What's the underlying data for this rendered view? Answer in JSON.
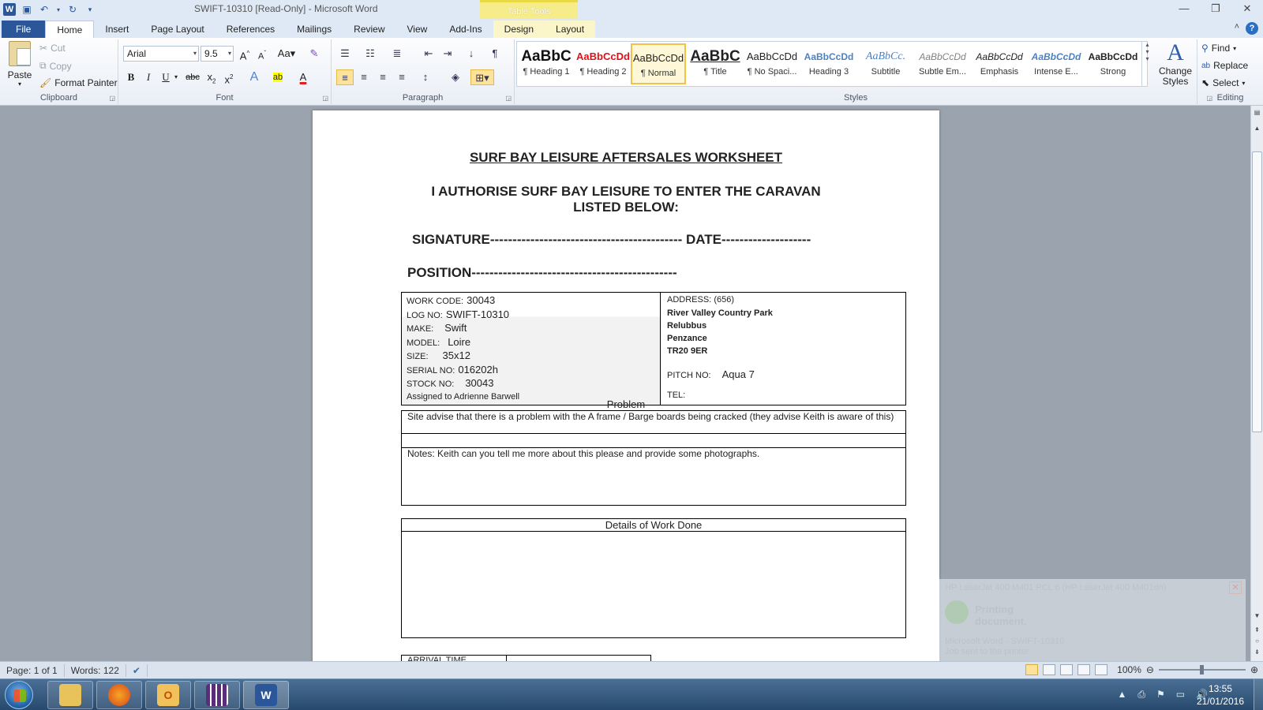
{
  "window": {
    "title": "SWIFT-10310 [Read-Only] - Microsoft Word",
    "context_tab": "Table Tools",
    "controls": [
      "—",
      "❐",
      "✕"
    ]
  },
  "tabs": [
    "File",
    "Home",
    "Insert",
    "Page Layout",
    "References",
    "Mailings",
    "Review",
    "View",
    "Add-Ins",
    "Design",
    "Layout"
  ],
  "ribbon": {
    "clipboard": {
      "label": "Clipboard",
      "paste": "Paste",
      "cut": "Cut",
      "copy": "Copy",
      "format_painter": "Format Painter"
    },
    "font": {
      "label": "Font",
      "font_name": "Arial",
      "font_size": "9.5"
    },
    "paragraph": {
      "label": "Paragraph"
    },
    "styles": {
      "label": "Styles",
      "items": [
        {
          "sample": "AaBbC",
          "name": "¶ Heading 1"
        },
        {
          "sample": "AaBbCcDd",
          "name": "¶ Heading 2"
        },
        {
          "sample": "AaBbCcDd",
          "name": "¶ Normal"
        },
        {
          "sample": "AaBbC",
          "name": "¶ Title"
        },
        {
          "sample": "AaBbCcDd",
          "name": "¶ No Spaci..."
        },
        {
          "sample": "AaBbCcDd",
          "name": "Heading 3"
        },
        {
          "sample": "AaBbCc.",
          "name": "Subtitle"
        },
        {
          "sample": "AaBbCcDd",
          "name": "Subtle Em..."
        },
        {
          "sample": "AaBbCcDd",
          "name": "Emphasis"
        },
        {
          "sample": "AaBbCcDd",
          "name": "Intense E..."
        },
        {
          "sample": "AaBbCcDd",
          "name": "Strong"
        }
      ],
      "change_styles": "Change Styles"
    },
    "editing": {
      "label": "Editing",
      "find": "Find",
      "replace": "Replace",
      "select": "Select"
    }
  },
  "document": {
    "title": "SURF BAY LEISURE AFTERSALES WORKSHEET",
    "authorise_line1": "I AUTHORISE SURF BAY LEISURE TO ENTER THE CARAVAN",
    "authorise_line2": "LISTED BELOW:",
    "signature_line": "SIGNATURE------------------------------------------- DATE--------------------",
    "position_line": "POSITION----------------------------------------------",
    "fields": [
      {
        "label": "WORK CODE:",
        "value": "30043"
      },
      {
        "label": "LOG NO:",
        "value": "SWIFT-10310"
      },
      {
        "label": "MAKE:",
        "value": "Swift"
      },
      {
        "label": "MODEL:",
        "value": "Loire"
      },
      {
        "label": "SIZE:",
        "value": "35x12"
      },
      {
        "label": "SERIAL NO:",
        "value": "016202h"
      },
      {
        "label": "STOCK NO:",
        "value": "30043"
      }
    ],
    "assigned": "Assigned to Adrienne Barwell",
    "address_label": "ADDRESS:",
    "address_code": "(656)",
    "address_lines": [
      "River Valley Country Park",
      "Relubbus",
      "Penzance",
      "TR20 9ER"
    ],
    "pitch_label": "PITCH NO:",
    "pitch_value": "Aqua 7",
    "tel_label": "TEL:",
    "problem_title": "Problem",
    "problem_text": "Site advise that there is a problem with the A frame / Barge boards being cracked  (they advise Keith is aware of this)",
    "notes_text": "Notes: Keith can you tell me more about this please and provide some photographs.",
    "details_title": "Details of Work Done",
    "arrival_label": "ARRIVAL TIME"
  },
  "toast": {
    "printer": "HP LaserJet 400 M401 PCL 6 (HP LaserJet 400 M401dn)",
    "status_line1": "Printing",
    "status_line2": "document.",
    "doc": "Microsoft Word - SWIFT-10310",
    "sent": "Job sent to the printer"
  },
  "status": {
    "page": "Page: 1 of 1",
    "words": "Words: 122",
    "zoom": "100%"
  },
  "clock": {
    "time": "13:55",
    "date": "21/01/2016"
  }
}
